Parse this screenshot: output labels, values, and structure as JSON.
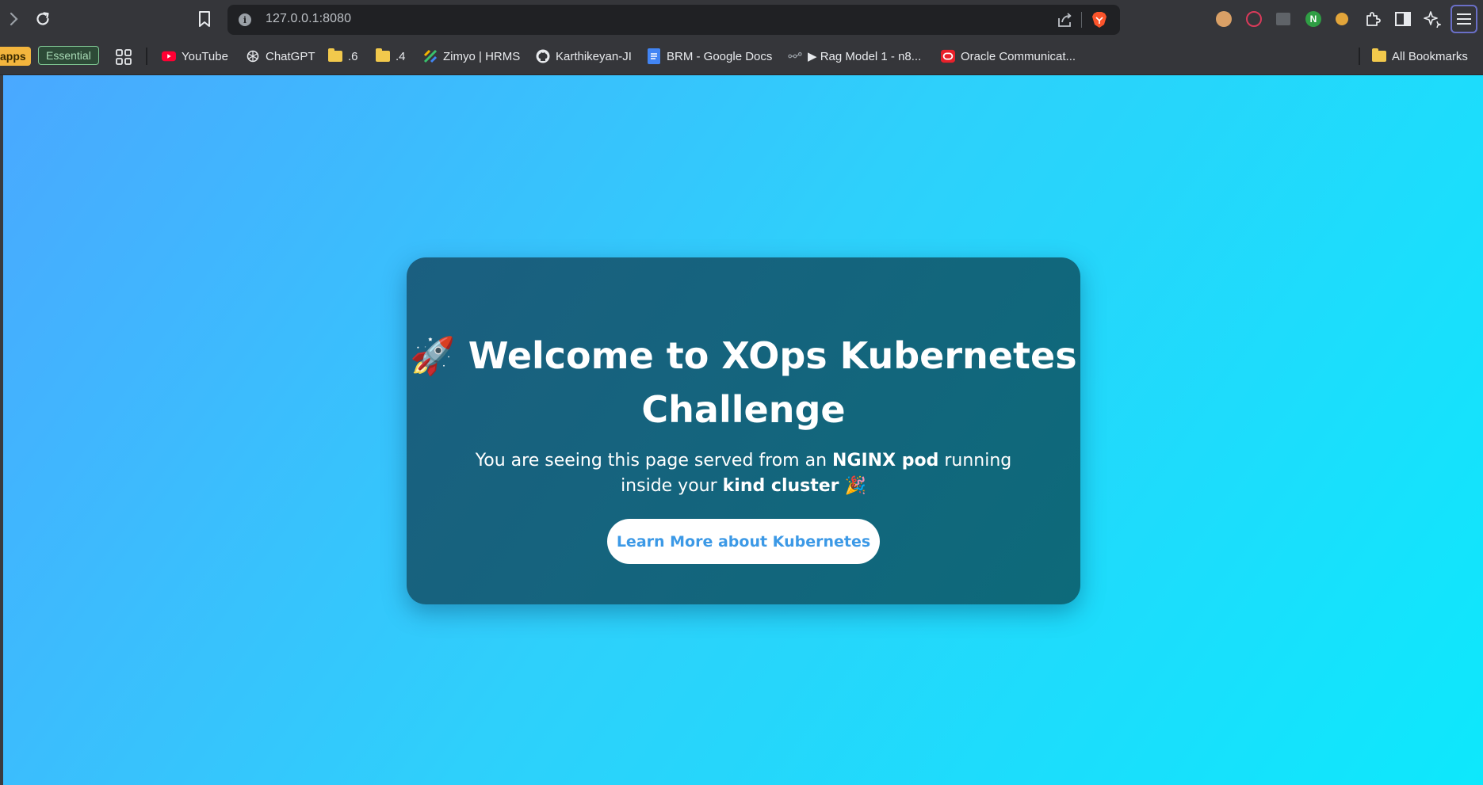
{
  "browser": {
    "url": "127.0.0.1:8080",
    "bookmarks": {
      "apps_label": "apps",
      "essential_label": "Essential",
      "items": [
        {
          "label": "YouTube",
          "icon": "youtube-icon"
        },
        {
          "label": "ChatGPT",
          "icon": "chatgpt-icon"
        },
        {
          "label": ".6",
          "icon": "folder-icon"
        },
        {
          "label": ".4",
          "icon": "folder-icon"
        },
        {
          "label": "Zimyo | HRMS",
          "icon": "zimyo-icon"
        },
        {
          "label": "Karthikeyan-JI",
          "icon": "github-icon"
        },
        {
          "label": "BRM - Google Docs",
          "icon": "google-docs-icon"
        },
        {
          "label": "▶ Rag Model 1 - n8...",
          "icon": "n8n-icon"
        },
        {
          "label": "Oracle Communicat...",
          "icon": "oracle-icon"
        }
      ],
      "all_bookmarks_label": "All Bookmarks"
    },
    "extensions": [
      "cookie-icon",
      "recorder-icon",
      "tab-grid-icon",
      "n-extension-icon",
      "cookie-editor-icon",
      "puzzle-icon",
      "sidebar-icon",
      "sparkle-icon"
    ],
    "colors": {
      "toolbar": "#35363a",
      "omnibox": "#202124",
      "menu_focus": "#6a6fc7"
    }
  },
  "page": {
    "title_emoji": "🚀",
    "title_text": "Welcome to XOps Kubernetes Challenge",
    "desc_before": "You are seeing this page served from an ",
    "desc_bold_1": "NGINX pod",
    "desc_middle": " running inside your ",
    "desc_bold_2": "kind cluster",
    "desc_emoji": "🎉",
    "button_label": "Learn More about Kubernetes",
    "colors": {
      "bg_start": "#4aa8ff",
      "bg_end": "#0de8fc",
      "card": "#145f7c",
      "button_text": "#3c99e6"
    }
  }
}
